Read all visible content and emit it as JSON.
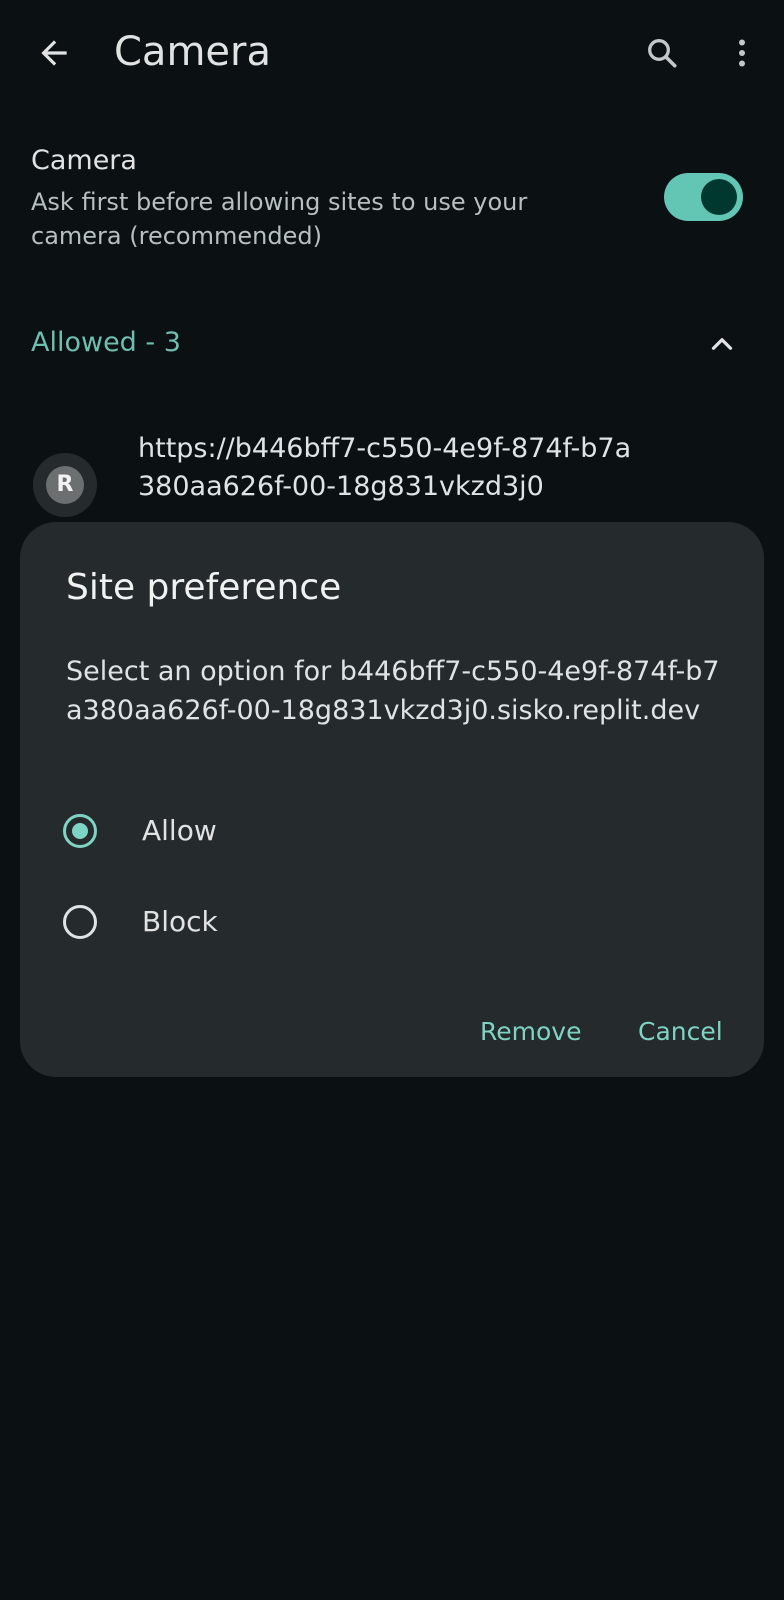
{
  "appbar": {
    "title": "Camera",
    "back_icon": "arrow-back-icon",
    "search_icon": "search-icon",
    "more_icon": "more-vert-icon"
  },
  "setting": {
    "title": "Camera",
    "summary": "Ask first before allowing sites to use your camera (recommended)",
    "toggle_on": true
  },
  "section": {
    "label": "Allowed - 3",
    "chevron_icon": "chevron-up-icon"
  },
  "site": {
    "avatar_letter": "R",
    "url": "https://b446bff7-c550-4e9f-874f-b7a380aa626f-00-18g831vkzd3j0"
  },
  "dialog": {
    "title": "Site preference",
    "message": "Select an option for b446bff7-c550-4e9f-874f-b7a380aa626f-00-18g831vkzd3j0.sisko.replit.dev",
    "options": [
      {
        "label": "Allow",
        "selected": true
      },
      {
        "label": "Block",
        "selected": false
      }
    ],
    "remove_label": "Remove",
    "cancel_label": "Cancel"
  },
  "colors": {
    "background": "#0b1113",
    "dialog": "#252a2c",
    "accent": "#7fd3c5",
    "section_accent": "#6fbfb0",
    "toggle_track": "#63c5b3"
  }
}
